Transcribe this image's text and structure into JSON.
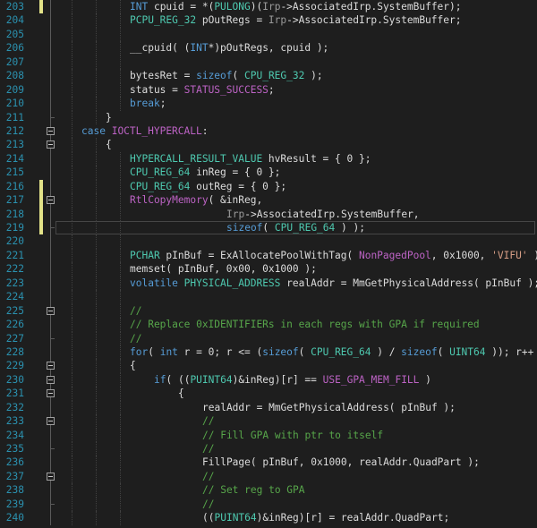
{
  "editor": {
    "colors": {
      "plain": "#dcdcdc",
      "keyword": "#569cd6",
      "type": "#4ec9b0",
      "macro": "#bd63c5",
      "comment": "#57a64a",
      "string": "#d69d85",
      "param": "#9a9a9a",
      "line_number": "#2b91af",
      "change_marker": "#e2e288"
    },
    "lines": [
      {
        "num": "203",
        "change": true,
        "fold": "line",
        "indent": 3,
        "tokens": [
          [
            "kw",
            "INT"
          ],
          [
            "plain",
            " cpuid = *("
          ],
          [
            "type",
            "PULONG"
          ],
          [
            "plain",
            ")("
          ],
          [
            "param",
            "Irp"
          ],
          [
            "plain",
            "->AssociatedIrp.SystemBuffer);"
          ]
        ]
      },
      {
        "num": "204",
        "change": false,
        "fold": "line",
        "indent": 3,
        "tokens": [
          [
            "type",
            "PCPU_REG_32"
          ],
          [
            "plain",
            " pOutRegs = "
          ],
          [
            "param",
            "Irp"
          ],
          [
            "plain",
            "->AssociatedIrp.SystemBuffer;"
          ]
        ]
      },
      {
        "num": "205",
        "change": false,
        "fold": "line",
        "indent": 3,
        "tokens": []
      },
      {
        "num": "206",
        "change": false,
        "fold": "line",
        "indent": 3,
        "tokens": [
          [
            "plain",
            "__cpuid( ("
          ],
          [
            "kw",
            "INT"
          ],
          [
            "plain",
            "*)pOutRegs, cpuid );"
          ]
        ]
      },
      {
        "num": "207",
        "change": false,
        "fold": "line",
        "indent": 3,
        "tokens": []
      },
      {
        "num": "208",
        "change": false,
        "fold": "line",
        "indent": 3,
        "tokens": [
          [
            "plain",
            "bytesRet = "
          ],
          [
            "kw",
            "sizeof"
          ],
          [
            "plain",
            "( "
          ],
          [
            "type",
            "CPU_REG_32"
          ],
          [
            "plain",
            " );"
          ]
        ]
      },
      {
        "num": "209",
        "change": false,
        "fold": "line",
        "indent": 3,
        "tokens": [
          [
            "plain",
            "status = "
          ],
          [
            "macro",
            "STATUS_SUCCESS"
          ],
          [
            "plain",
            ";"
          ]
        ]
      },
      {
        "num": "210",
        "change": false,
        "fold": "line",
        "indent": 3,
        "tokens": [
          [
            "kw",
            "break"
          ],
          [
            "plain",
            ";"
          ]
        ]
      },
      {
        "num": "211",
        "change": false,
        "fold": "end",
        "indent": 2,
        "tokens": [
          [
            "plain",
            "}"
          ]
        ]
      },
      {
        "num": "212",
        "change": false,
        "fold": "box",
        "indent": 1,
        "tokens": [
          [
            "kw",
            "case"
          ],
          [
            "plain",
            " "
          ],
          [
            "macro",
            "IOCTL_HYPERCALL"
          ],
          [
            "plain",
            ":"
          ]
        ]
      },
      {
        "num": "213",
        "change": false,
        "fold": "box",
        "indent": 2,
        "tokens": [
          [
            "plain",
            "{"
          ]
        ]
      },
      {
        "num": "214",
        "change": false,
        "fold": "line",
        "indent": 3,
        "tokens": [
          [
            "type",
            "HYPERCALL_RESULT_VALUE"
          ],
          [
            "plain",
            " hvResult = { 0 };"
          ]
        ]
      },
      {
        "num": "215",
        "change": false,
        "fold": "line",
        "indent": 3,
        "tokens": [
          [
            "type",
            "CPU_REG_64"
          ],
          [
            "plain",
            " inReg = { 0 };"
          ]
        ]
      },
      {
        "num": "216",
        "change": true,
        "fold": "line",
        "indent": 3,
        "tokens": [
          [
            "type",
            "CPU_REG_64"
          ],
          [
            "plain",
            " outReg = { 0 };"
          ]
        ]
      },
      {
        "num": "217",
        "change": true,
        "fold": "box",
        "indent": 3,
        "tokens": [
          [
            "macro",
            "RtlCopyMemory"
          ],
          [
            "plain",
            "( &inReg,"
          ]
        ]
      },
      {
        "num": "218",
        "change": true,
        "fold": "line",
        "indent": 7,
        "tokens": [
          [
            "param",
            "Irp"
          ],
          [
            "plain",
            "->AssociatedIrp.SystemBuffer,"
          ]
        ]
      },
      {
        "num": "219",
        "change": true,
        "fold": "end",
        "indent": 7,
        "current": true,
        "tokens": [
          [
            "kw",
            "sizeof"
          ],
          [
            "plain",
            "( "
          ],
          [
            "type",
            "CPU_REG_64"
          ],
          [
            "plain",
            " ) );"
          ]
        ]
      },
      {
        "num": "220",
        "change": false,
        "fold": "line",
        "indent": 3,
        "tokens": []
      },
      {
        "num": "221",
        "change": false,
        "fold": "line",
        "indent": 3,
        "tokens": [
          [
            "type",
            "PCHAR"
          ],
          [
            "plain",
            " pInBuf = ExAllocatePoolWithTag( "
          ],
          [
            "macro",
            "NonPagedPool"
          ],
          [
            "plain",
            ", 0x1000, "
          ],
          [
            "str",
            "'VIFU'"
          ],
          [
            "plain",
            " );"
          ]
        ]
      },
      {
        "num": "222",
        "change": false,
        "fold": "line",
        "indent": 3,
        "tokens": [
          [
            "plain",
            "memset( pInBuf, 0x00, 0x1000 );"
          ]
        ]
      },
      {
        "num": "223",
        "change": false,
        "fold": "line",
        "indent": 3,
        "tokens": [
          [
            "kw",
            "volatile"
          ],
          [
            "plain",
            " "
          ],
          [
            "type",
            "PHYSICAL_ADDRESS"
          ],
          [
            "plain",
            " realAddr = MmGetPhysicalAddress( pInBuf );"
          ]
        ]
      },
      {
        "num": "224",
        "change": false,
        "fold": "line",
        "indent": 3,
        "tokens": []
      },
      {
        "num": "225",
        "change": false,
        "fold": "box",
        "indent": 3,
        "tokens": [
          [
            "comment",
            "//"
          ]
        ]
      },
      {
        "num": "226",
        "change": false,
        "fold": "line",
        "indent": 3,
        "tokens": [
          [
            "comment",
            "// Replace 0xIDENTIFIERs in each regs with GPA if required"
          ]
        ]
      },
      {
        "num": "227",
        "change": false,
        "fold": "end",
        "indent": 3,
        "tokens": [
          [
            "comment",
            "//"
          ]
        ]
      },
      {
        "num": "228",
        "change": false,
        "fold": "line",
        "indent": 3,
        "tokens": [
          [
            "kw",
            "for"
          ],
          [
            "plain",
            "( "
          ],
          [
            "kw",
            "int"
          ],
          [
            "plain",
            " r = 0; r <= ("
          ],
          [
            "kw",
            "sizeof"
          ],
          [
            "plain",
            "( "
          ],
          [
            "type",
            "CPU_REG_64"
          ],
          [
            "plain",
            " ) / "
          ],
          [
            "kw",
            "sizeof"
          ],
          [
            "plain",
            "( "
          ],
          [
            "type",
            "UINT64"
          ],
          [
            "plain",
            " )); r++ )"
          ]
        ]
      },
      {
        "num": "229",
        "change": false,
        "fold": "box",
        "indent": 3,
        "tokens": [
          [
            "plain",
            "{"
          ]
        ]
      },
      {
        "num": "230",
        "change": false,
        "fold": "box",
        "indent": 4,
        "tokens": [
          [
            "kw",
            "if"
          ],
          [
            "plain",
            "( (("
          ],
          [
            "type",
            "PUINT64"
          ],
          [
            "plain",
            ")&inReg)[r] == "
          ],
          [
            "macro",
            "USE_GPA_MEM_FILL"
          ],
          [
            "plain",
            " )"
          ]
        ]
      },
      {
        "num": "231",
        "change": false,
        "fold": "box",
        "indent": 5,
        "tokens": [
          [
            "plain",
            "{"
          ]
        ]
      },
      {
        "num": "232",
        "change": false,
        "fold": "line",
        "indent": 6,
        "tokens": [
          [
            "plain",
            "realAddr = MmGetPhysicalAddress( pInBuf );"
          ]
        ]
      },
      {
        "num": "233",
        "change": false,
        "fold": "box",
        "indent": 6,
        "tokens": [
          [
            "comment",
            "//"
          ]
        ]
      },
      {
        "num": "234",
        "change": false,
        "fold": "line",
        "indent": 6,
        "tokens": [
          [
            "comment",
            "// Fill GPA with ptr to itself"
          ]
        ]
      },
      {
        "num": "235",
        "change": false,
        "fold": "end",
        "indent": 6,
        "tokens": [
          [
            "comment",
            "//"
          ]
        ]
      },
      {
        "num": "236",
        "change": false,
        "fold": "line",
        "indent": 6,
        "tokens": [
          [
            "plain",
            "FillPage( pInBuf, 0x1000, realAddr.QuadPart );"
          ]
        ]
      },
      {
        "num": "237",
        "change": false,
        "fold": "box",
        "indent": 6,
        "tokens": [
          [
            "comment",
            "//"
          ]
        ]
      },
      {
        "num": "238",
        "change": false,
        "fold": "line",
        "indent": 6,
        "tokens": [
          [
            "comment",
            "// Set reg to GPA"
          ]
        ]
      },
      {
        "num": "239",
        "change": false,
        "fold": "end",
        "indent": 6,
        "tokens": [
          [
            "comment",
            "//"
          ]
        ]
      },
      {
        "num": "240",
        "change": false,
        "fold": "line",
        "indent": 6,
        "tokens": [
          [
            "plain",
            "(("
          ],
          [
            "type",
            "PUINT64"
          ],
          [
            "plain",
            ")&inReg)[r] = realAddr.QuadPart;"
          ]
        ]
      }
    ]
  }
}
